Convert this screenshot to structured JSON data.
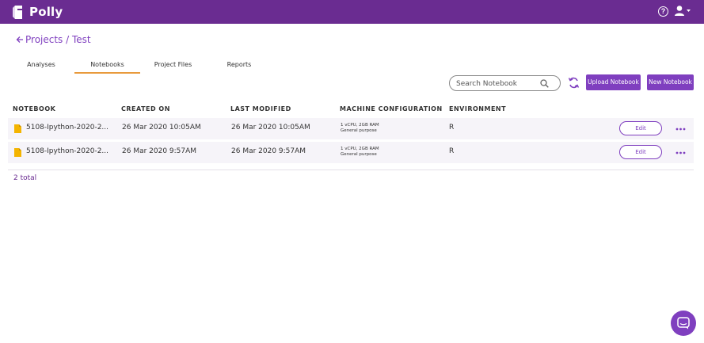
{
  "app": {
    "name": "Polly"
  },
  "colors": {
    "brand": "#6a2c91",
    "accent": "#7f3fbf",
    "tab_underline": "#e89a3c",
    "row_bg": "#f6f4f9"
  },
  "header": {
    "icons": [
      "polly-logo-icon",
      "help-icon",
      "user-icon",
      "caret-down-icon"
    ]
  },
  "breadcrumb": {
    "text": "Projects / Test",
    "icon": "arrow-left-icon"
  },
  "tabs": [
    {
      "label": "Analyses",
      "active": false
    },
    {
      "label": "Notebooks",
      "active": true
    },
    {
      "label": "Project Files",
      "active": false
    },
    {
      "label": "Reports",
      "active": false
    }
  ],
  "toolbar": {
    "search_placeholder": "Search Notebook",
    "search_icon": "search-icon",
    "refresh_icon": "refresh-icon",
    "upload_label": "Upload Notebook",
    "new_label": "New Notebook"
  },
  "table": {
    "headers": [
      "NOTEBOOK",
      "CREATED ON",
      "LAST MODIFIED",
      "MACHINE CONFIGURATION",
      "ENVIRONMENT"
    ],
    "rows": [
      {
        "name": "5108-Ipython-2020-2...",
        "created": "26 Mar 2020 10:05AM",
        "modified": "26 Mar 2020 10:05AM",
        "machine_line1": "1 vCPU, 2GB RAM",
        "machine_line2": "General purpose",
        "environment": "R",
        "edit_label": "Edit"
      },
      {
        "name": "5108-Ipython-2020-2...",
        "created": "26 Mar 2020 9:57AM",
        "modified": "26 Mar 2020 9:57AM",
        "machine_line1": "1 vCPU, 2GB RAM",
        "machine_line2": "General purpose",
        "environment": "R",
        "edit_label": "Edit"
      }
    ],
    "total_text": "2 total"
  },
  "chat": {
    "icon": "chat-icon"
  }
}
